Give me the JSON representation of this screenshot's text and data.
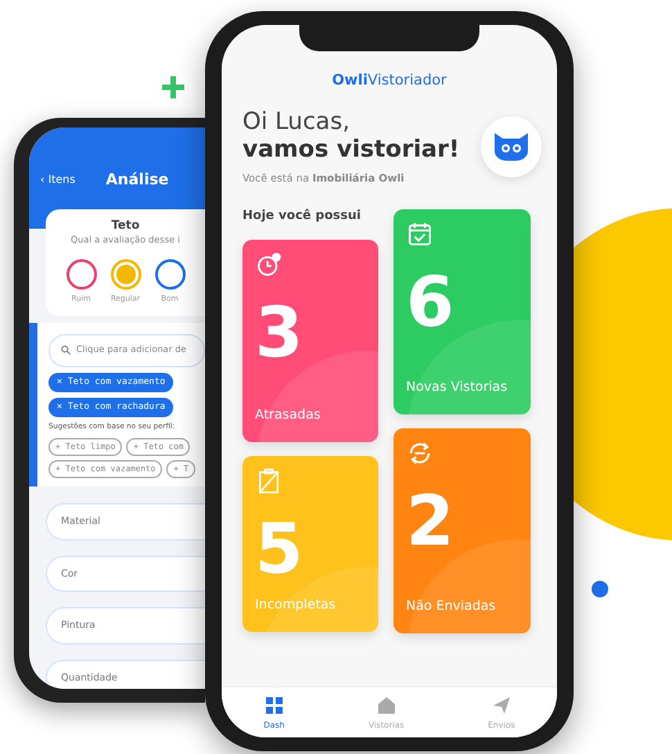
{
  "back_phone": {
    "header": {
      "back": "‹ Itens",
      "title": "Análise"
    },
    "question": {
      "title": "Teto",
      "subtitle": "Qual a avaliação desse i"
    },
    "ratings": [
      {
        "label": "Ruim",
        "color": "#e8436a",
        "selected": false
      },
      {
        "label": "Regular",
        "color": "#f5b800",
        "selected": true
      },
      {
        "label": "Bom",
        "color": "#1e6fe8",
        "selected": false
      }
    ],
    "search": {
      "placeholder": "Clique para adicionar de"
    },
    "selected_tags": [
      "× Teto com vazamento",
      "× Teto com rachadura"
    ],
    "suggestions_label": "Sugestões com base no seu perfil:",
    "suggestions": [
      "+ Teto limpo",
      "+ Teto com",
      "+ Teto com vazamento",
      "+ T"
    ],
    "fields": [
      {
        "placeholder": "Material"
      },
      {
        "placeholder": "Cor"
      },
      {
        "placeholder": "Pintura"
      },
      {
        "placeholder": "Quantidade"
      }
    ]
  },
  "front_phone": {
    "logo": "**Owli**Vistoriador",
    "greeting": "Oi Lucas,",
    "headline": "vamos vistoriar!",
    "subtitle": "Você está na **Imobiliária Owli**",
    "section": "Hoje você possui",
    "cards": [
      {
        "kind": "late",
        "count": "3",
        "label": "Atrasadas",
        "color": "#ff4d78"
      },
      {
        "kind": "new",
        "count": "6",
        "label": "Novas Vistorias",
        "color": "#2dcc62"
      },
      {
        "kind": "incomplete",
        "count": "5",
        "label": "Incompletas",
        "color": "#ffc21c"
      },
      {
        "kind": "unsent",
        "count": "2",
        "label": "Não Enviadas",
        "color": "#ff8412"
      }
    ],
    "tabs": [
      {
        "label": "Dash",
        "selected": true
      },
      {
        "label": "Vistorias",
        "selected": false
      },
      {
        "label": "Envios",
        "selected": false
      }
    ]
  }
}
